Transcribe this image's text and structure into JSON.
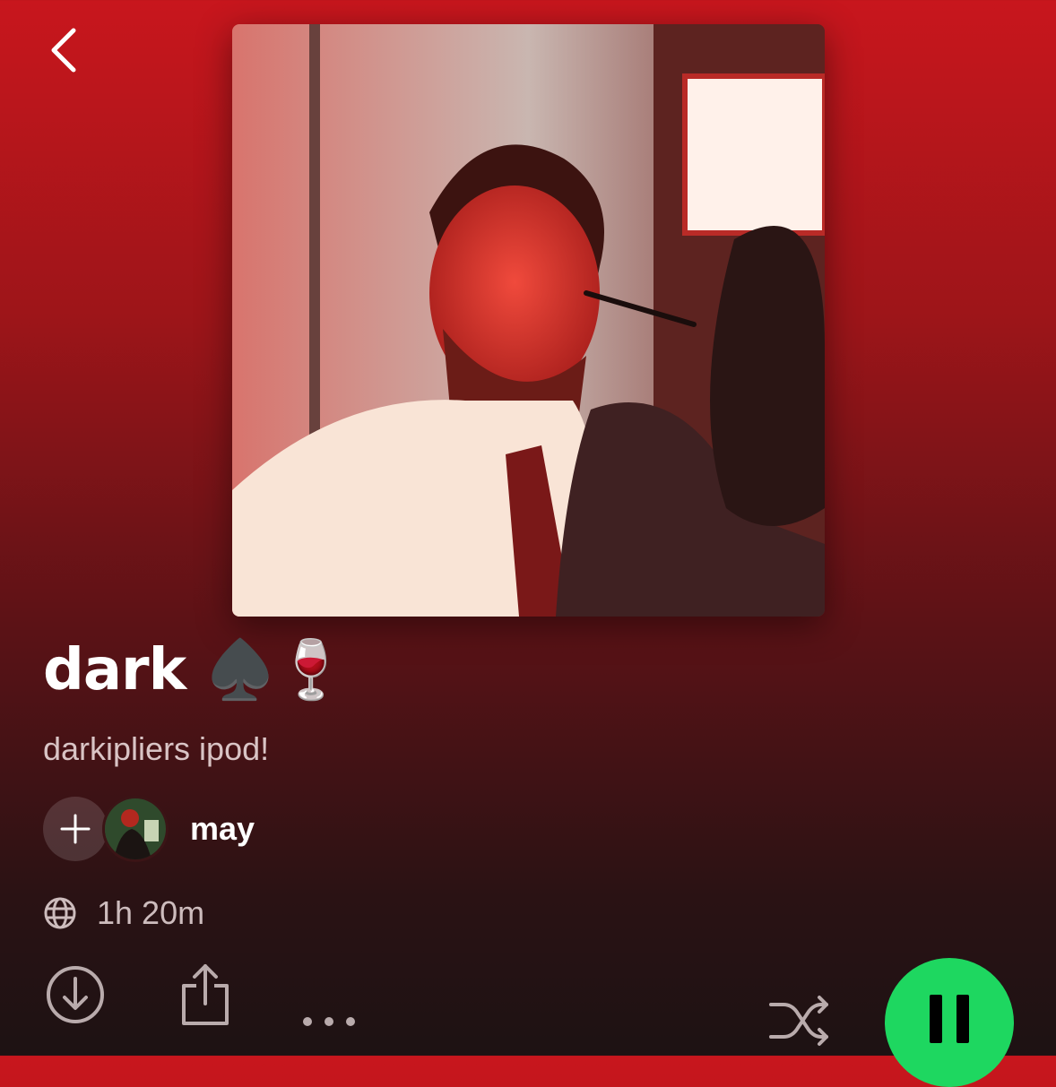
{
  "header": {
    "back_icon": "chevron-left-icon"
  },
  "playlist": {
    "title": "dark ♠️🍷",
    "description": "darkipliers ipod!",
    "owner": {
      "name": "may",
      "avatar": "user-avatar"
    },
    "visibility_icon": "globe-icon",
    "duration": "1h 20m"
  },
  "actions": {
    "download_icon": "download-circle-icon",
    "share_icon": "share-icon",
    "more_icon": "more-horizontal-icon",
    "shuffle_icon": "shuffle-icon",
    "play_pause_icon": "pause-icon"
  },
  "colors": {
    "accent_green": "#1ed760",
    "gradient_top": "#c8161d",
    "gradient_bottom": "#1d1213"
  }
}
